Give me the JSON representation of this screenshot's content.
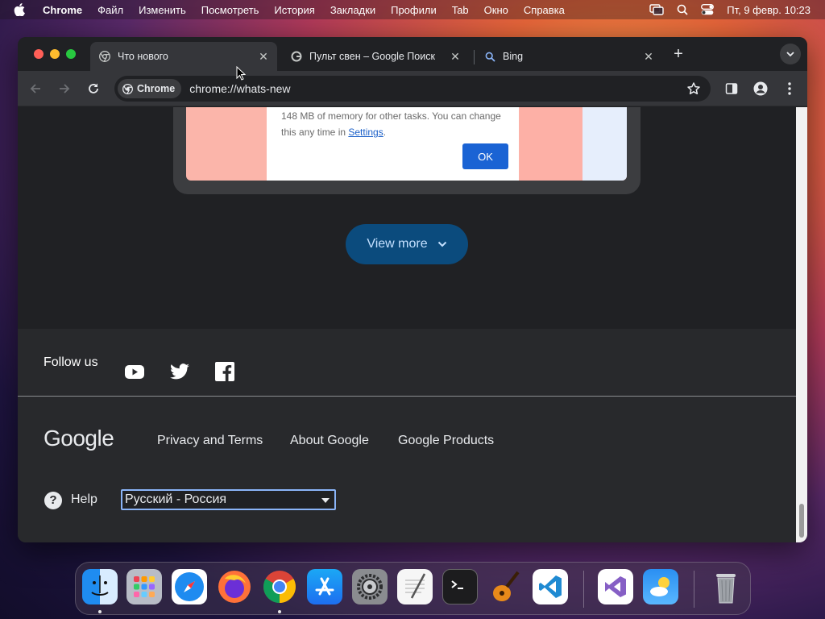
{
  "menubar": {
    "app_name": "Chrome",
    "items": [
      "Файл",
      "Изменить",
      "Посмотреть",
      "История",
      "Закладки",
      "Профили",
      "Tab",
      "Окно",
      "Справка"
    ],
    "clock": "Пт, 9 февр. 10:23"
  },
  "tabs": [
    {
      "title": "Что нового",
      "active": true
    },
    {
      "title": "Пульт свен – Google Поиск",
      "active": false
    },
    {
      "title": "Bing",
      "active": false
    }
  ],
  "toolbar": {
    "chip_label": "Chrome",
    "url": "chrome://whats-new"
  },
  "content": {
    "dialog_text_before": "148 MB of memory for other tasks. You can change this any time in ",
    "dialog_link": "Settings",
    "dialog_text_after": ".",
    "ok_label": "OK",
    "view_more_label": "View more"
  },
  "footer": {
    "follow_us": "Follow us",
    "logo_text": "Google",
    "links": [
      "Privacy and Terms",
      "About Google",
      "Google Products"
    ],
    "help": "Help",
    "language_selected": "Русский - Россия"
  },
  "dock": {
    "apps": [
      "Finder",
      "Launchpad",
      "Safari",
      "Firefox",
      "Chrome",
      "App Store",
      "System Settings",
      "TextEdit",
      "Terminal",
      "GarageBand",
      "Visual Studio Code",
      "Visual Studio",
      "Weather",
      "Trash"
    ]
  }
}
